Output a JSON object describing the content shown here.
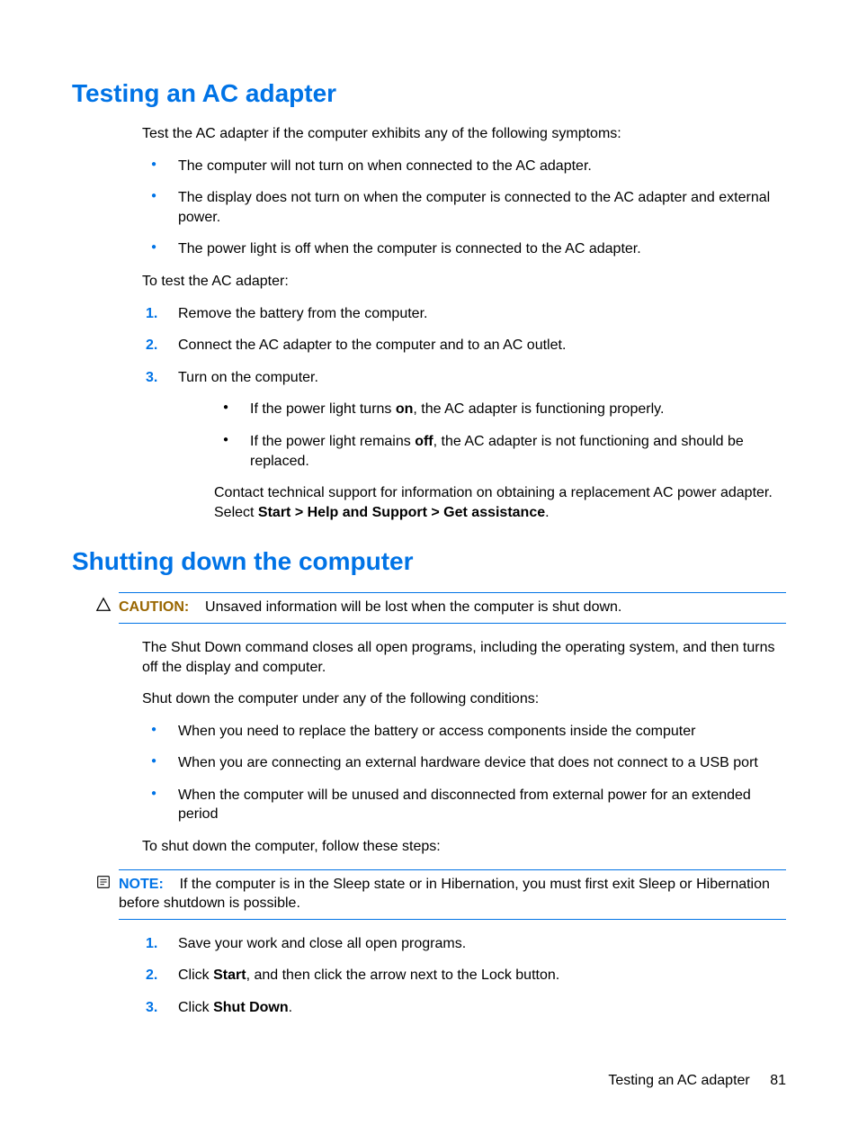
{
  "section1": {
    "heading": "Testing an AC adapter",
    "intro": "Test the AC adapter if the computer exhibits any of the following symptoms:",
    "symptoms": [
      "The computer will not turn on when connected to the AC adapter.",
      "The display does not turn on when the computer is connected to the AC adapter and external power.",
      "The power light is off when the computer is connected to the AC adapter."
    ],
    "test_intro": "To test the AC adapter:",
    "steps": [
      "Remove the battery from the computer.",
      "Connect the AC adapter to the computer and to an AC outlet.",
      "Turn on the computer."
    ],
    "sub_bullets": {
      "b1_pre": "If the power light turns ",
      "b1_bold": "on",
      "b1_post": ", the AC adapter is functioning properly.",
      "b2_pre": "If the power light remains ",
      "b2_bold": "off",
      "b2_post": ", the AC adapter is not functioning and should be replaced."
    },
    "contact_pre": "Contact technical support for information on obtaining a replacement AC power adapter. Select ",
    "contact_bold": "Start > Help and Support > Get assistance",
    "contact_post": "."
  },
  "section2": {
    "heading": "Shutting down the computer",
    "caution_label": "CAUTION:",
    "caution_text": "Unsaved information will be lost when the computer is shut down.",
    "p1": "The Shut Down command closes all open programs, including the operating system, and then turns off the display and computer.",
    "p2": "Shut down the computer under any of the following conditions:",
    "conditions": [
      "When you need to replace the battery or access components inside the computer",
      "When you are connecting an external hardware device that does not connect to a USB port",
      "When the computer will be unused and disconnected from external power for an extended period"
    ],
    "p3": "To shut down the computer, follow these steps:",
    "note_label": "NOTE:",
    "note_text": "If the computer is in the Sleep state or in Hibernation, you must first exit Sleep or Hibernation before shutdown is possible.",
    "steps": {
      "s1": "Save your work and close all open programs.",
      "s2_pre": "Click ",
      "s2_b1": "Start",
      "s2_post": ", and then click the arrow next to the Lock button.",
      "s3_pre": "Click ",
      "s3_b1": "Shut Down",
      "s3_post": "."
    }
  },
  "footer": {
    "title": "Testing an AC adapter",
    "page": "81"
  }
}
